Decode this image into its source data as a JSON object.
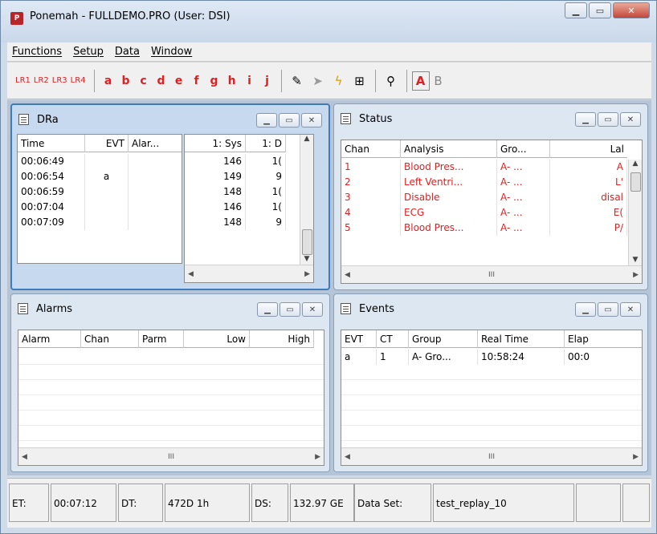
{
  "window": {
    "title": "Ponemah - FULLDEMO.PRO (User: DSI)",
    "icon_label": "P"
  },
  "menu": [
    "Functions",
    "Setup",
    "Data",
    "Window"
  ],
  "toolbar": {
    "lr_buttons": [
      "LR1",
      "LR2",
      "LR3",
      "LR4"
    ],
    "event_letters": [
      "a",
      "b",
      "c",
      "d",
      "e",
      "f",
      "g",
      "h",
      "i",
      "j"
    ],
    "mode_a": "A",
    "mode_b": "B"
  },
  "dra": {
    "title": "DRa",
    "left_headers": [
      "Time",
      "EVT",
      "Alar..."
    ],
    "right_headers": [
      "1: Sys",
      "1: D"
    ],
    "rows": [
      {
        "time": "00:06:49",
        "evt": "",
        "sys": "146",
        "d": "1("
      },
      {
        "time": "00:06:54",
        "evt": "a",
        "sys": "149",
        "d": "9"
      },
      {
        "time": "00:06:59",
        "evt": "",
        "sys": "148",
        "d": "1("
      },
      {
        "time": "00:07:04",
        "evt": "",
        "sys": "146",
        "d": "1("
      },
      {
        "time": "00:07:09",
        "evt": "",
        "sys": "148",
        "d": "9"
      }
    ]
  },
  "status": {
    "title": "Status",
    "headers": [
      "Chan",
      "Analysis",
      "Gro...",
      "Lal"
    ],
    "rows": [
      {
        "chan": "1",
        "analysis": "Blood Pres...",
        "group": "A- ...",
        "label": "A"
      },
      {
        "chan": "2",
        "analysis": "Left Ventri...",
        "group": "A- ...",
        "label": "L'"
      },
      {
        "chan": "3",
        "analysis": "Disable",
        "group": "A- ...",
        "label": "disal"
      },
      {
        "chan": "4",
        "analysis": "ECG",
        "group": "A- ...",
        "label": "E("
      },
      {
        "chan": "5",
        "analysis": "Blood Pres...",
        "group": "A- ...",
        "label": "P/"
      }
    ]
  },
  "alarms": {
    "title": "Alarms",
    "headers": [
      "Alarm",
      "Chan",
      "Parm",
      "Low",
      "High"
    ]
  },
  "events": {
    "title": "Events",
    "headers": [
      "EVT",
      "CT",
      "Group",
      "Real Time",
      "Elap"
    ],
    "rows": [
      {
        "evt": "a",
        "ct": "1",
        "group": "A- Gro...",
        "real_time": "10:58:24",
        "elap": "00:0"
      }
    ]
  },
  "statusbar": {
    "et_label": "ET:",
    "et_value": "00:07:12",
    "dt_label": "DT:",
    "dt_value": "472D 1h",
    "ds_label": "DS:",
    "ds_value": "132.97 GE",
    "dataset_label": "Data Set:",
    "dataset_value": "test_replay_10"
  }
}
